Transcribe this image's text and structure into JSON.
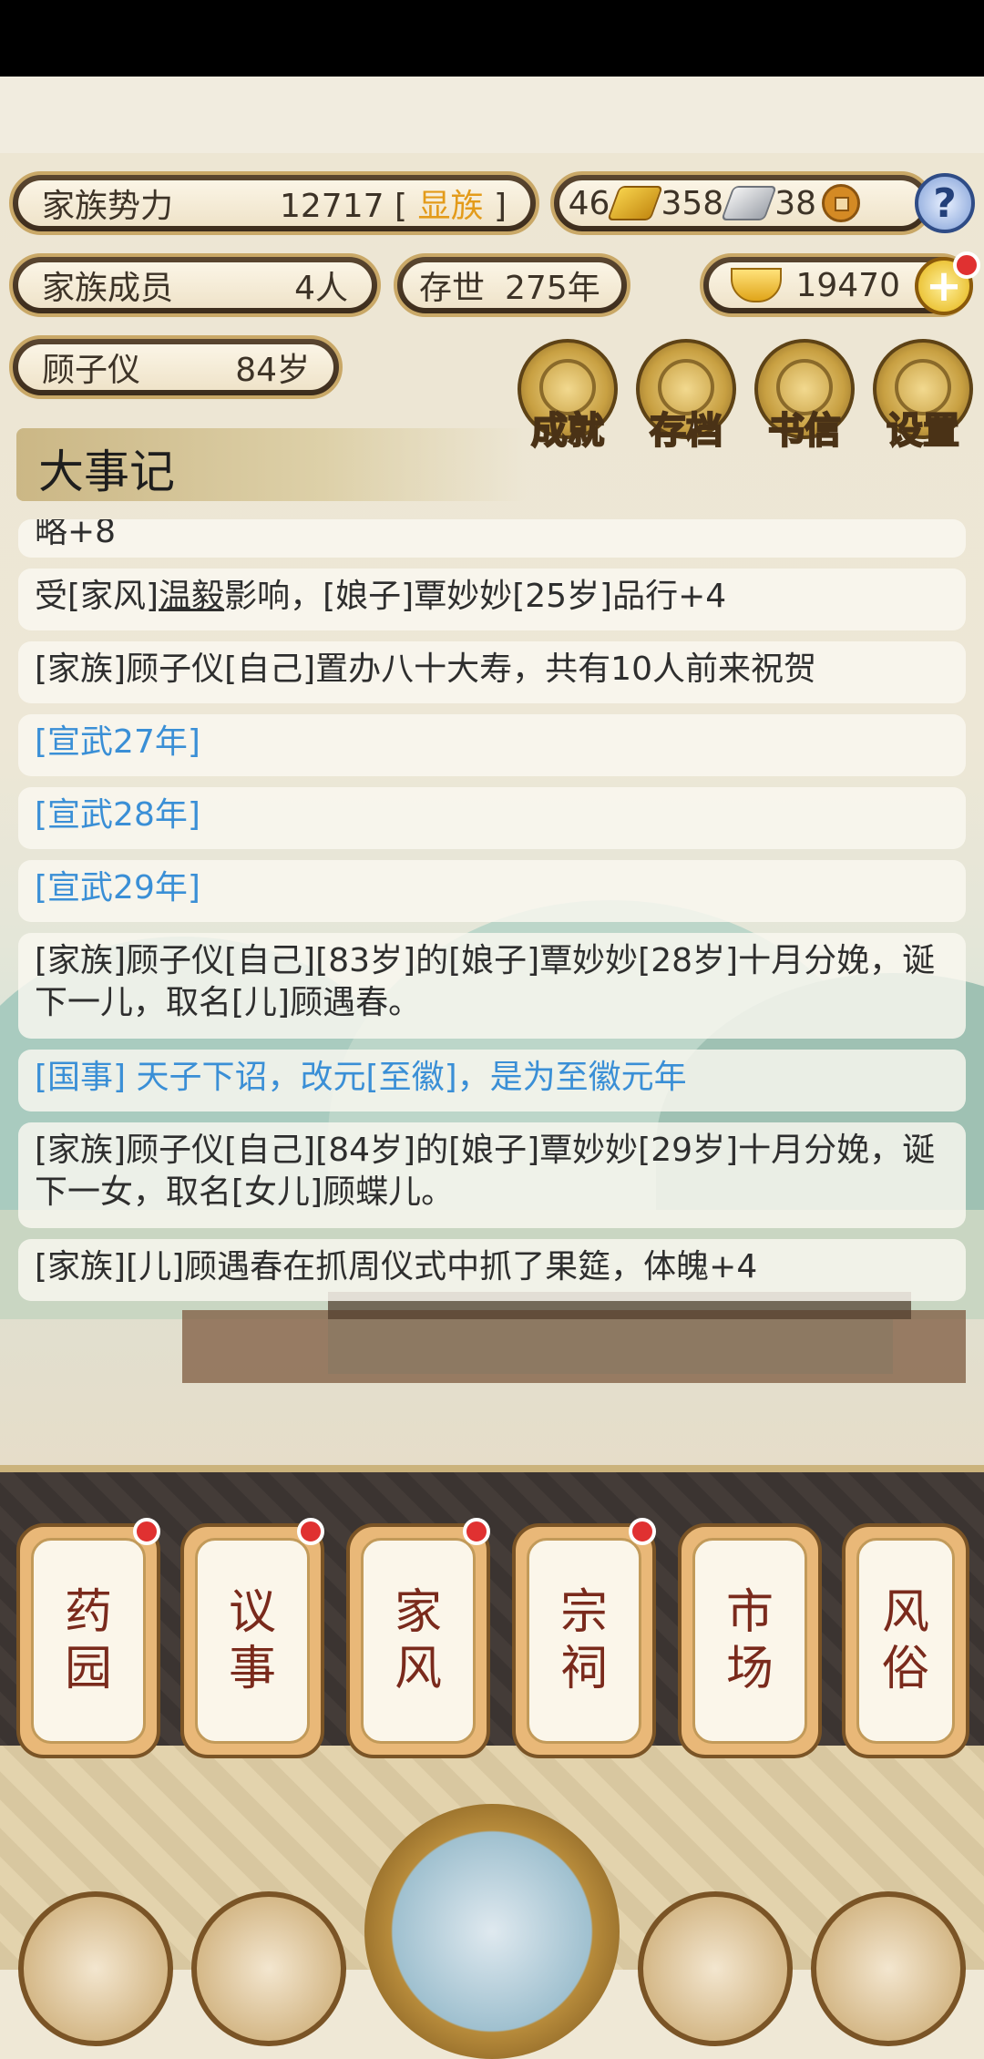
{
  "stats": {
    "clan_power_label": "家族势力",
    "clan_power_value": "12717",
    "clan_rank_open": "[",
    "clan_rank": "显族",
    "clan_rank_close": "]",
    "gold": "46",
    "silver": "358",
    "copper": "38",
    "members_label": "家族成员",
    "members_value": "4人",
    "existence_label": "存世",
    "existence_value": "275年",
    "ingot": "19470",
    "leader_name": "顾子仪",
    "leader_age": "84岁"
  },
  "menu": [
    {
      "label": "成就",
      "icon": "achievement-icon"
    },
    {
      "label": "存档",
      "icon": "save-icon"
    },
    {
      "label": "书信",
      "icon": "letter-icon"
    },
    {
      "label": "设置",
      "icon": "settings-icon"
    }
  ],
  "chronicle": {
    "title": "大事记",
    "partial_top": "略+8",
    "entries": [
      {
        "pre": "受[家风]",
        "ul": "温毅",
        "post": "影响，[娘子]覃妙妙[25岁]品行+4"
      },
      {
        "text": "[家族]顾子仪[自己]置办八十大寿，共有10人前来祝贺"
      },
      {
        "text": "[宣武27年]"
      },
      {
        "text": "[宣武28年]"
      },
      {
        "text": "[宣武29年]"
      },
      {
        "text": "[家族]顾子仪[自己][83岁]的[娘子]覃妙妙[28岁]十月分娩，诞下一儿，取名[儿]顾遇春。"
      },
      {
        "text": "[国事] 天子下诏，改元[至徽]，是为至徽元年"
      },
      {
        "text": "[家族]顾子仪[自己][84岁]的[娘子]覃妙妙[29岁]十月分娩，诞下一女，取名[女儿]顾蝶儿。"
      },
      {
        "text": "[家族][儿]顾遇春在抓周仪式中抓了果筵，体魄+4"
      }
    ]
  },
  "buildings": [
    {
      "l1": "药",
      "l2": "园",
      "badge": true
    },
    {
      "l1": "议",
      "l2": "事",
      "badge": true
    },
    {
      "l1": "家",
      "l2": "风",
      "badge": true
    },
    {
      "l1": "宗",
      "l2": "祠",
      "badge": true
    },
    {
      "l1": "市",
      "l2": "场",
      "badge": false
    },
    {
      "l1": "风",
      "l2": "俗",
      "badge": false
    }
  ],
  "colors": {
    "accent_orange": "#e39b1a",
    "link_blue": "#3a8fd6",
    "badge_red": "#e03131"
  }
}
